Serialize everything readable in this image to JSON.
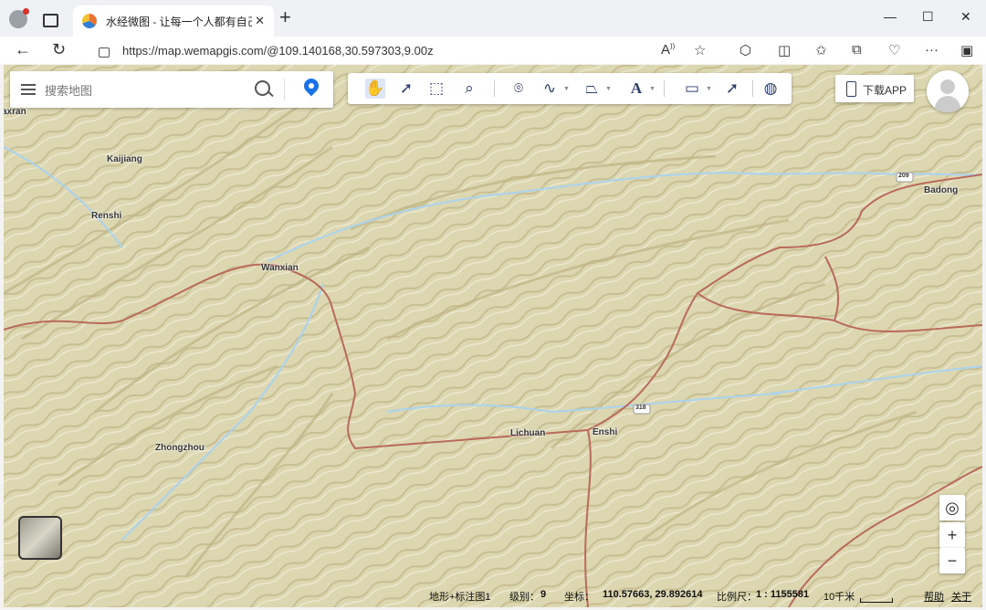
{
  "browser": {
    "tab_title": "水经微图 - 让每一个人都有自己的地图",
    "url": "https://map.wemapgis.com/@109.140168,30.597303,9.00z"
  },
  "search": {
    "placeholder": "搜索地图"
  },
  "toolbar": {
    "tools": [
      "pan-hand-icon",
      "select-arrow-icon",
      "box-select-icon",
      "zoom-area-icon",
      "marker-icon",
      "polyline-icon",
      "polygon-icon",
      "text-icon",
      "measure-icon",
      "identify-icon",
      "globe-icon"
    ]
  },
  "download_label": "下载APP",
  "map_labels": [
    {
      "name": "axran"
    },
    {
      "name": "Kaijiang"
    },
    {
      "name": "Renshi"
    },
    {
      "name": "Wanxian"
    },
    {
      "name": "Zhongzhou"
    },
    {
      "name": "Lichuan"
    },
    {
      "name": "Enshi"
    },
    {
      "name": "Badong"
    },
    {
      "name": "209"
    },
    {
      "name": "318"
    }
  ],
  "status": {
    "layer": "地形+标注图1",
    "level_label": "级别：",
    "level": "9",
    "coord_label": "坐标：",
    "coord": "110.57663, 29.892614",
    "scale_label": "比例尺：",
    "scale": "1 : 1155581",
    "distance": "10千米",
    "help": "帮助",
    "about": "关于"
  },
  "controls": {
    "locate": "◎",
    "zoom_in": "+",
    "zoom_out": "−"
  },
  "colors": {
    "map_base": "#ded9b4",
    "river": "#a9d3ee",
    "border": "#b96a5a",
    "accent": "#1a73e8"
  }
}
